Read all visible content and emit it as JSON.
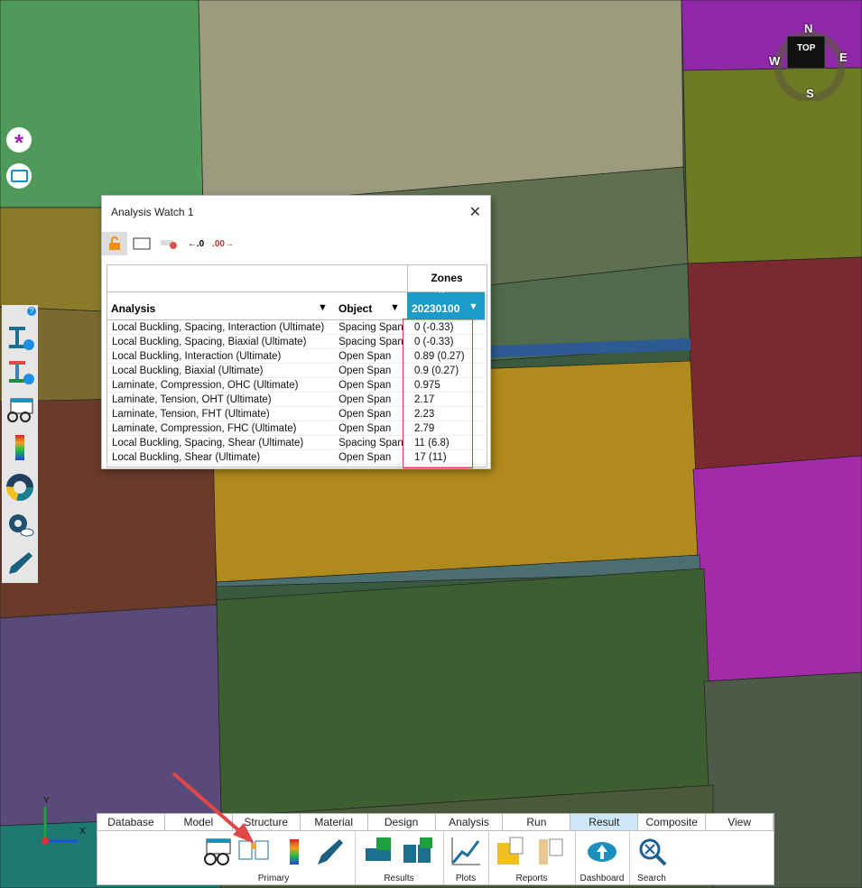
{
  "window": {
    "title": "Analysis Watch 1",
    "close": "✕"
  },
  "compass": {
    "top": "TOP",
    "n": "N",
    "s": "S",
    "e": "E",
    "w": "W"
  },
  "table": {
    "zones_header": "Zones",
    "col_analysis": "Analysis",
    "col_object": "Object",
    "col_zone": "20230100",
    "rows": [
      {
        "analysis": "Local Buckling, Spacing, Interaction (Ultimate)",
        "object": "Spacing Span",
        "value": "0 (-0.33)"
      },
      {
        "analysis": "Local Buckling, Spacing, Biaxial (Ultimate)",
        "object": "Spacing Span",
        "value": "0 (-0.33)"
      },
      {
        "analysis": "Local Buckling, Interaction (Ultimate)",
        "object": "Open Span",
        "value": "0.89 (0.27)"
      },
      {
        "analysis": "Local Buckling, Biaxial (Ultimate)",
        "object": "Open Span",
        "value": "0.9 (0.27)"
      },
      {
        "analysis": "Laminate, Compression, OHC (Ultimate)",
        "object": "Open Span",
        "value": "0.975"
      },
      {
        "analysis": "Laminate, Tension, OHT (Ultimate)",
        "object": "Open Span",
        "value": "2.17"
      },
      {
        "analysis": "Laminate, Tension, FHT (Ultimate)",
        "object": "Open Span",
        "value": "2.23"
      },
      {
        "analysis": "Laminate, Compression, FHC (Ultimate)",
        "object": "Open Span",
        "value": "2.79"
      },
      {
        "analysis": "Local Buckling, Spacing, Shear (Ultimate)",
        "object": "Spacing Span",
        "value": "11 (6.8)"
      },
      {
        "analysis": "Local Buckling, Shear (Ultimate)",
        "object": "Open Span",
        "value": "17 (11)"
      }
    ]
  },
  "ribbon": {
    "tabs": [
      "Database",
      "Model",
      "Structure",
      "Material",
      "Design",
      "Analysis",
      "Run",
      "Result",
      "Composite",
      "View"
    ],
    "active_tab": "Result",
    "groups": [
      "Primary",
      "Results",
      "Plots",
      "Reports",
      "Dashboard",
      "Search"
    ]
  },
  "axes": {
    "x": "X",
    "y": "Y"
  },
  "colors": {
    "accent": "#1c9bc9",
    "highlight": "#e04040",
    "purple": "#8e28a8",
    "olive": "#6e7a24"
  }
}
